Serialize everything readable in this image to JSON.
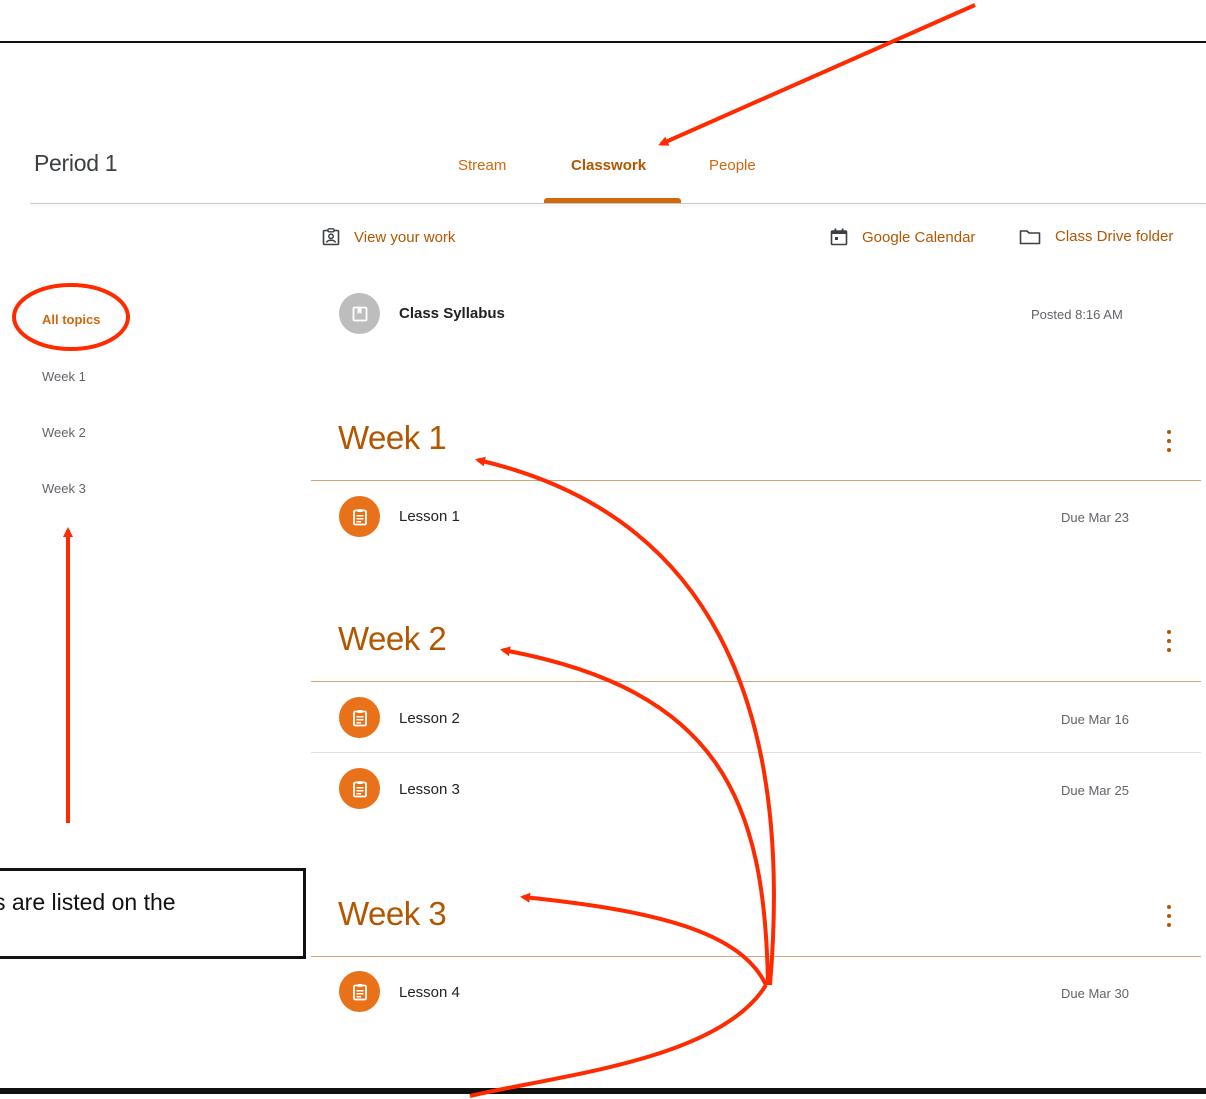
{
  "header": {
    "class_name": "Period 1",
    "tabs": [
      {
        "label": "Stream",
        "active": false
      },
      {
        "label": "Classwork",
        "active": true
      },
      {
        "label": "People",
        "active": false
      }
    ]
  },
  "toolbar": {
    "view_work_label": "View your work",
    "calendar_label": "Google Calendar",
    "drive_label": "Class Drive folder"
  },
  "sidebar": {
    "items": [
      {
        "label": "All topics",
        "active": true
      },
      {
        "label": "Week 1",
        "active": false
      },
      {
        "label": "Week 2",
        "active": false
      },
      {
        "label": "Week 3",
        "active": false
      }
    ]
  },
  "material": {
    "title": "Class Syllabus",
    "meta": "Posted 8:16 AM",
    "icon": "material-icon"
  },
  "topics": [
    {
      "title": "Week 1",
      "items": [
        {
          "title": "Lesson 1",
          "meta": "Due Mar 23",
          "icon": "assignment-icon"
        }
      ]
    },
    {
      "title": "Week 2",
      "items": [
        {
          "title": "Lesson 2",
          "meta": "Due Mar 16",
          "icon": "assignment-icon"
        },
        {
          "title": "Lesson 3",
          "meta": "Due Mar 25",
          "icon": "assignment-icon"
        }
      ]
    },
    {
      "title": "Week 3",
      "items": [
        {
          "title": "Lesson 4",
          "meta": "Due Mar 30",
          "icon": "assignment-icon"
        }
      ]
    }
  ],
  "annotation": {
    "callout_text": "s are listed on the",
    "arrow_color": "#ff2a00"
  },
  "colors": {
    "accent": "#d2680c",
    "accent_dark": "#b35600",
    "assignment_icon_bg": "#e8711a",
    "material_icon_bg": "#bdbdbd"
  }
}
